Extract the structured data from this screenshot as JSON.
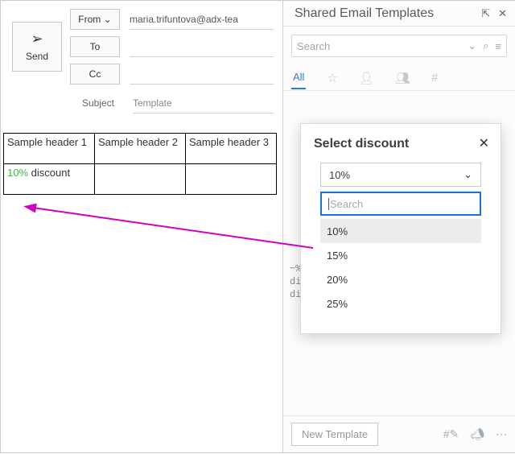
{
  "compose": {
    "send": "Send",
    "from_label": "From",
    "from_value": "maria.trifuntova@adx-tea",
    "to_label": "To",
    "to_value": "",
    "cc_label": "Cc",
    "cc_value": "",
    "subject_label": "Subject",
    "subject_value": "Template"
  },
  "table": {
    "headers": [
      "Sample header 1",
      "Sample header 2",
      "Sample header 3"
    ],
    "row1": {
      "discount_value": "10%",
      "discount_word": "discount",
      "c2": "",
      "c3": ""
    }
  },
  "panel": {
    "title": "Shared Email Templates",
    "search_placeholder": "Search",
    "tab_all": "All",
    "snippet": "~%\ndi\ndi",
    "new_template": "New Template"
  },
  "modal": {
    "title": "Select discount",
    "current": "10%",
    "search_placeholder": "Search",
    "options": [
      "10%",
      "15%",
      "20%",
      "25%"
    ]
  }
}
